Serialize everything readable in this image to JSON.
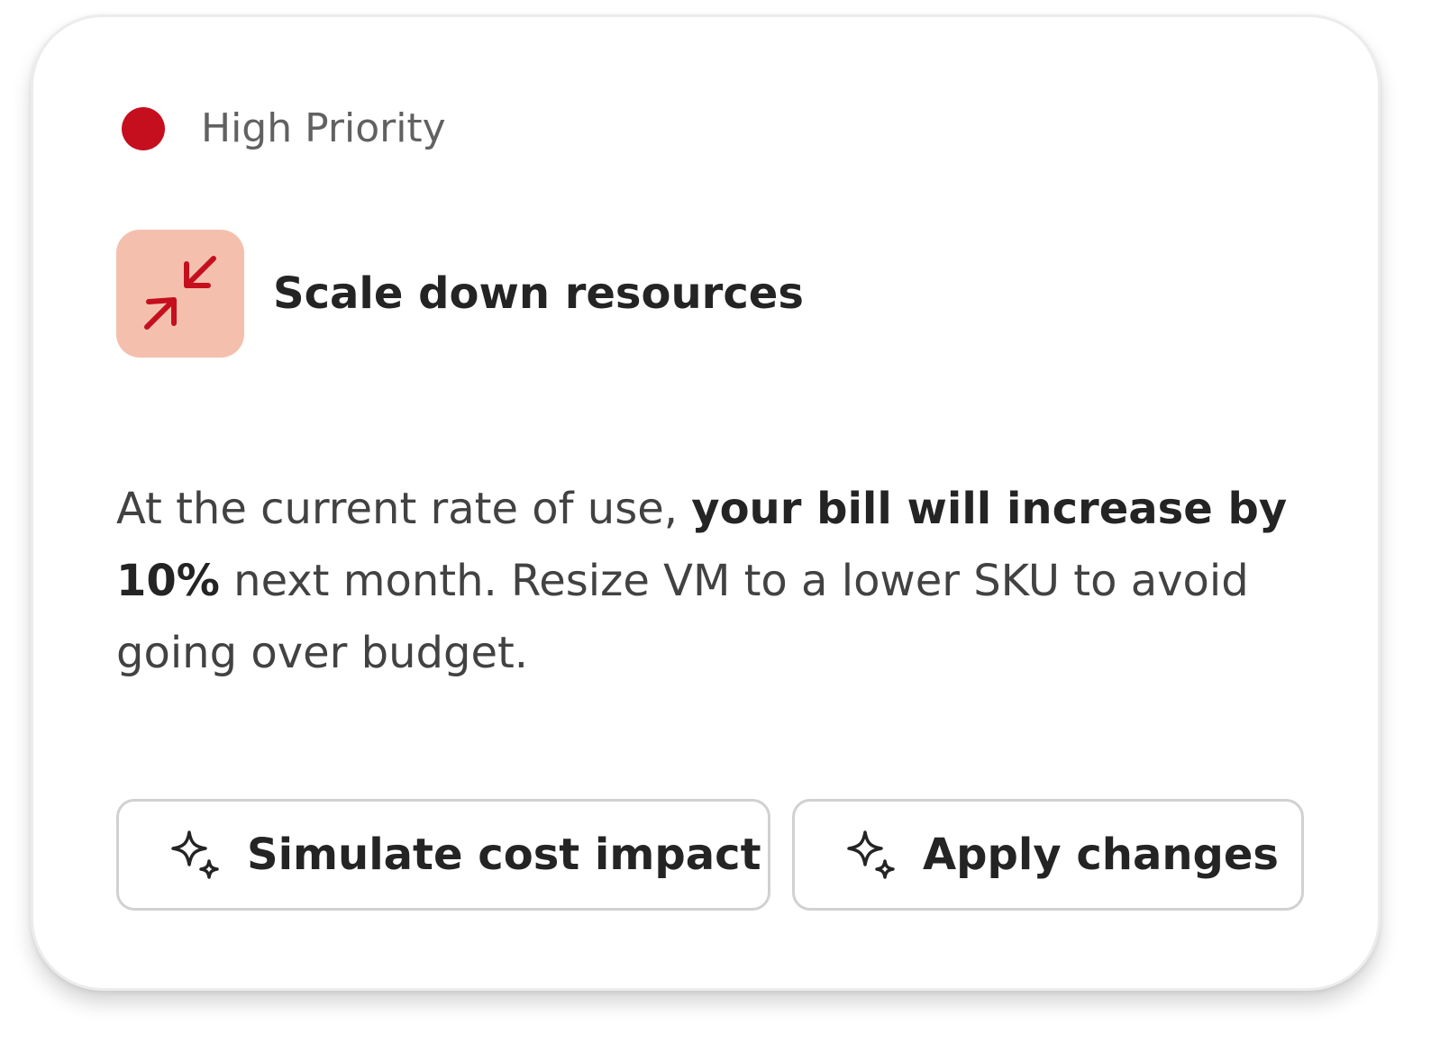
{
  "colors": {
    "priority_dot": "#c50f1f",
    "icon_background": "#f4c0ad",
    "icon_stroke": "#c50f1f"
  },
  "priority": {
    "label": "High Priority"
  },
  "recommendation": {
    "icon": "collapse-arrows-icon",
    "title": "Scale down resources"
  },
  "description": {
    "intro": "At the current rate of use, ",
    "bold": "your bill will increase by 10%",
    "rest": " next month. Resize VM to a lower SKU to avoid going over budget."
  },
  "actions": {
    "simulate_icon": "sparkle-icon",
    "simulate_label": "Simulate cost impact",
    "apply_icon": "sparkle-icon",
    "apply_label": "Apply changes"
  }
}
